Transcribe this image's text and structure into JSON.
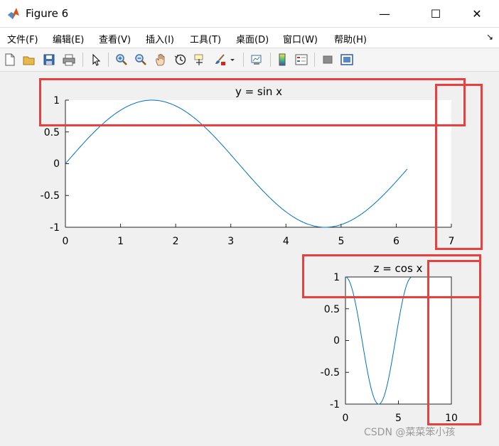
{
  "window": {
    "title": "Figure 6",
    "minimize": "—",
    "maximize": "☐",
    "close": "✕"
  },
  "menu": {
    "items": [
      "文件(F)",
      "编辑(E)",
      "查看(V)",
      "插入(I)",
      "工具(T)",
      "桌面(D)",
      "窗口(W)",
      "帮助(H)"
    ],
    "overflow": "↘"
  },
  "toolbar": {
    "icons": [
      "new-figure-icon",
      "open-icon",
      "save-icon",
      "print-icon",
      "pointer-icon",
      "zoom-in-icon",
      "zoom-out-icon",
      "pan-icon",
      "rotate-icon",
      "data-cursor-icon",
      "brush-icon",
      "link-icon",
      "colorbar-icon",
      "legend-icon",
      "hide-plot-tools-icon",
      "show-plot-tools-icon"
    ]
  },
  "chart_data": [
    {
      "type": "line",
      "title": "y = sin x",
      "xlabel": "",
      "ylabel": "",
      "xlim": [
        0,
        7
      ],
      "ylim": [
        -1,
        1
      ],
      "xticks": [
        "0",
        "1",
        "2",
        "3",
        "4",
        "5",
        "6",
        "7"
      ],
      "yticks": [
        "1",
        "0.5",
        "0",
        "-0.5",
        "-1"
      ],
      "function": "sin",
      "x_range": [
        0,
        6.2
      ],
      "grid": false,
      "color": "#0072bd"
    },
    {
      "type": "line",
      "title": "z = cos x",
      "xlabel": "",
      "ylabel": "",
      "xlim": [
        0,
        10
      ],
      "ylim": [
        -1,
        1
      ],
      "xticks": [
        "0",
        "5",
        "10"
      ],
      "yticks": [
        "1",
        "0.5",
        "0",
        "-0.5",
        "-1"
      ],
      "function": "cos",
      "x_range": [
        0,
        6.2
      ],
      "grid": false,
      "color": "#0072bd"
    }
  ],
  "watermark": "CSDN @菜菜笨小孩",
  "colors": {
    "annotation": "#e8403e",
    "line": "#0072bd"
  }
}
